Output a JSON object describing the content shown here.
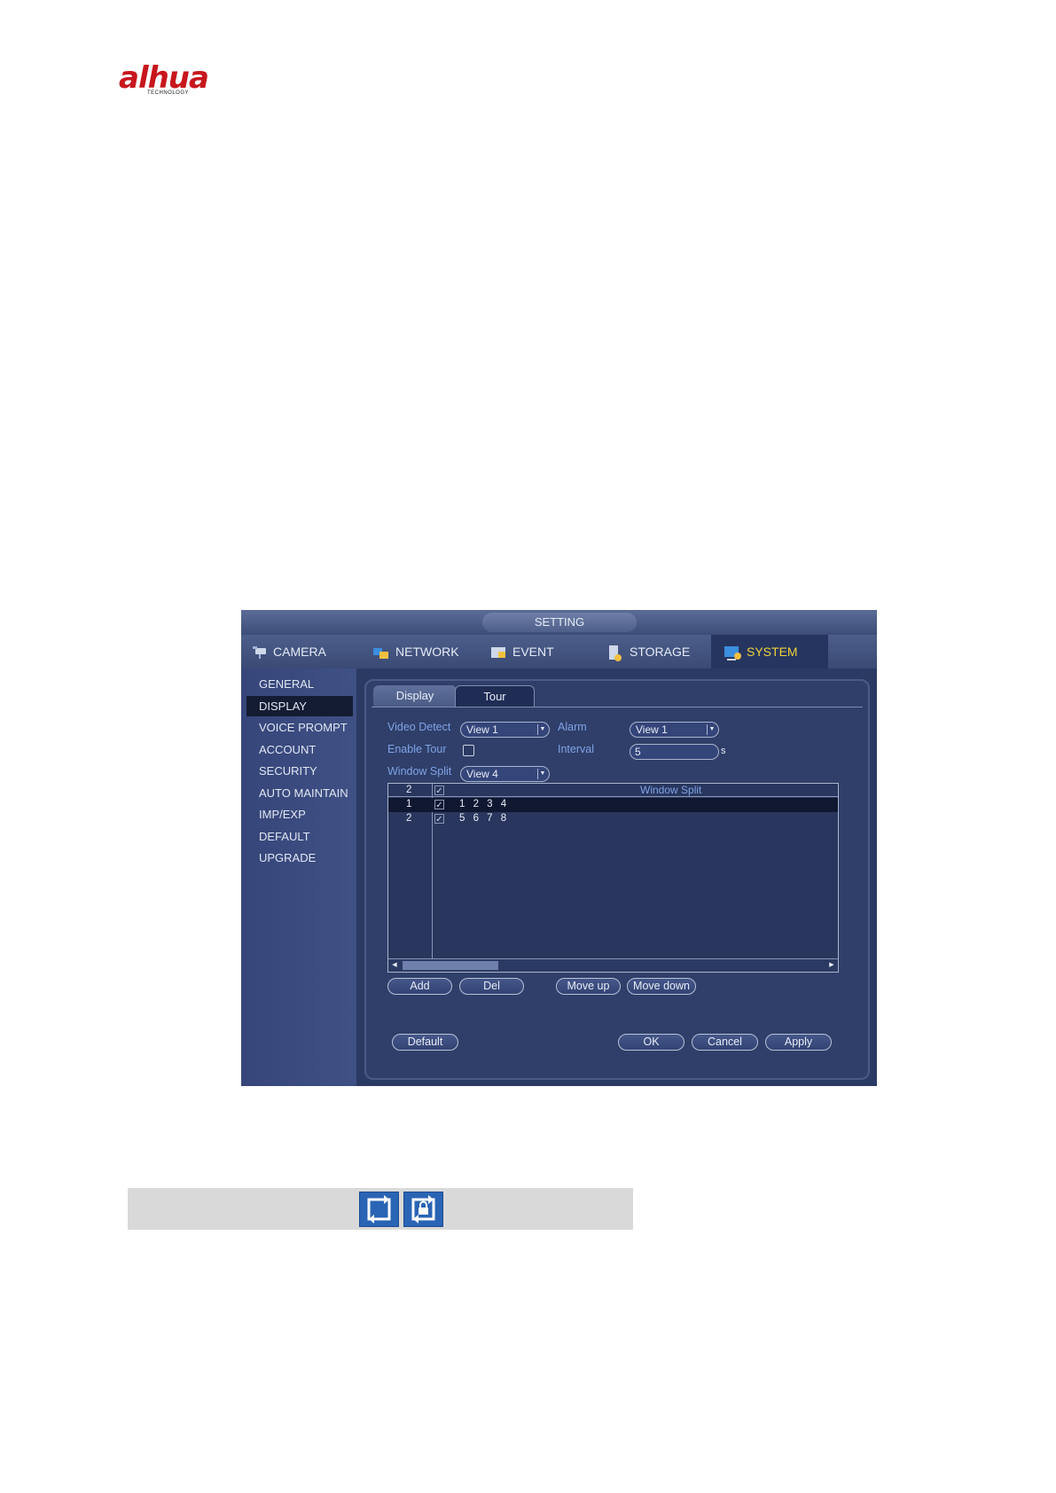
{
  "logo": {
    "text": "alhua",
    "subtext": "TECHNOLOGY"
  },
  "window": {
    "title": "SETTING",
    "main_tabs": [
      {
        "label": "CAMERA",
        "icon": "camera-icon"
      },
      {
        "label": "NETWORK",
        "icon": "network-icon"
      },
      {
        "label": "EVENT",
        "icon": "event-icon"
      },
      {
        "label": "STORAGE",
        "icon": "storage-icon"
      },
      {
        "label": "SYSTEM",
        "icon": "system-icon",
        "active": true
      }
    ],
    "sidebar": {
      "items": [
        "GENERAL",
        "DISPLAY",
        "VOICE PROMPT",
        "ACCOUNT",
        "SECURITY",
        "AUTO MAINTAIN",
        "IMP/EXP",
        "DEFAULT",
        "UPGRADE"
      ],
      "active": "DISPLAY"
    },
    "sub_tabs": [
      {
        "label": "Display"
      },
      {
        "label": "Tour",
        "active": true
      }
    ],
    "form": {
      "video_detect_label": "Video Detect",
      "video_detect_value": "View 1",
      "alarm_label": "Alarm",
      "alarm_value": "View 1",
      "enable_tour_label": "Enable Tour",
      "enable_tour_checked": false,
      "interval_label": "Interval",
      "interval_value": "5",
      "interval_unit": "s",
      "window_split_label": "Window Split",
      "window_split_value": "View 4"
    },
    "table": {
      "header_count": "2",
      "header_title": "Window Split",
      "rows": [
        {
          "num": "1",
          "checked": true,
          "channels": "1 2 3 4",
          "selected": true
        },
        {
          "num": "2",
          "checked": true,
          "channels": "5 6 7 8",
          "selected": false
        }
      ]
    },
    "list_buttons": {
      "add": "Add",
      "del": "Del",
      "move_up": "Move up",
      "move_down": "Move down"
    },
    "footer_buttons": {
      "default": "Default",
      "ok": "OK",
      "cancel": "Cancel",
      "apply": "Apply"
    }
  },
  "colors": {
    "accent": "#f0d33a",
    "label_blue": "#7fa3e6",
    "panel": "#2f3f69",
    "logo_red": "#c8161d",
    "icon_blue": "#2a64b4"
  },
  "note_icons": [
    "tour-start-icon",
    "tour-lock-icon"
  ]
}
